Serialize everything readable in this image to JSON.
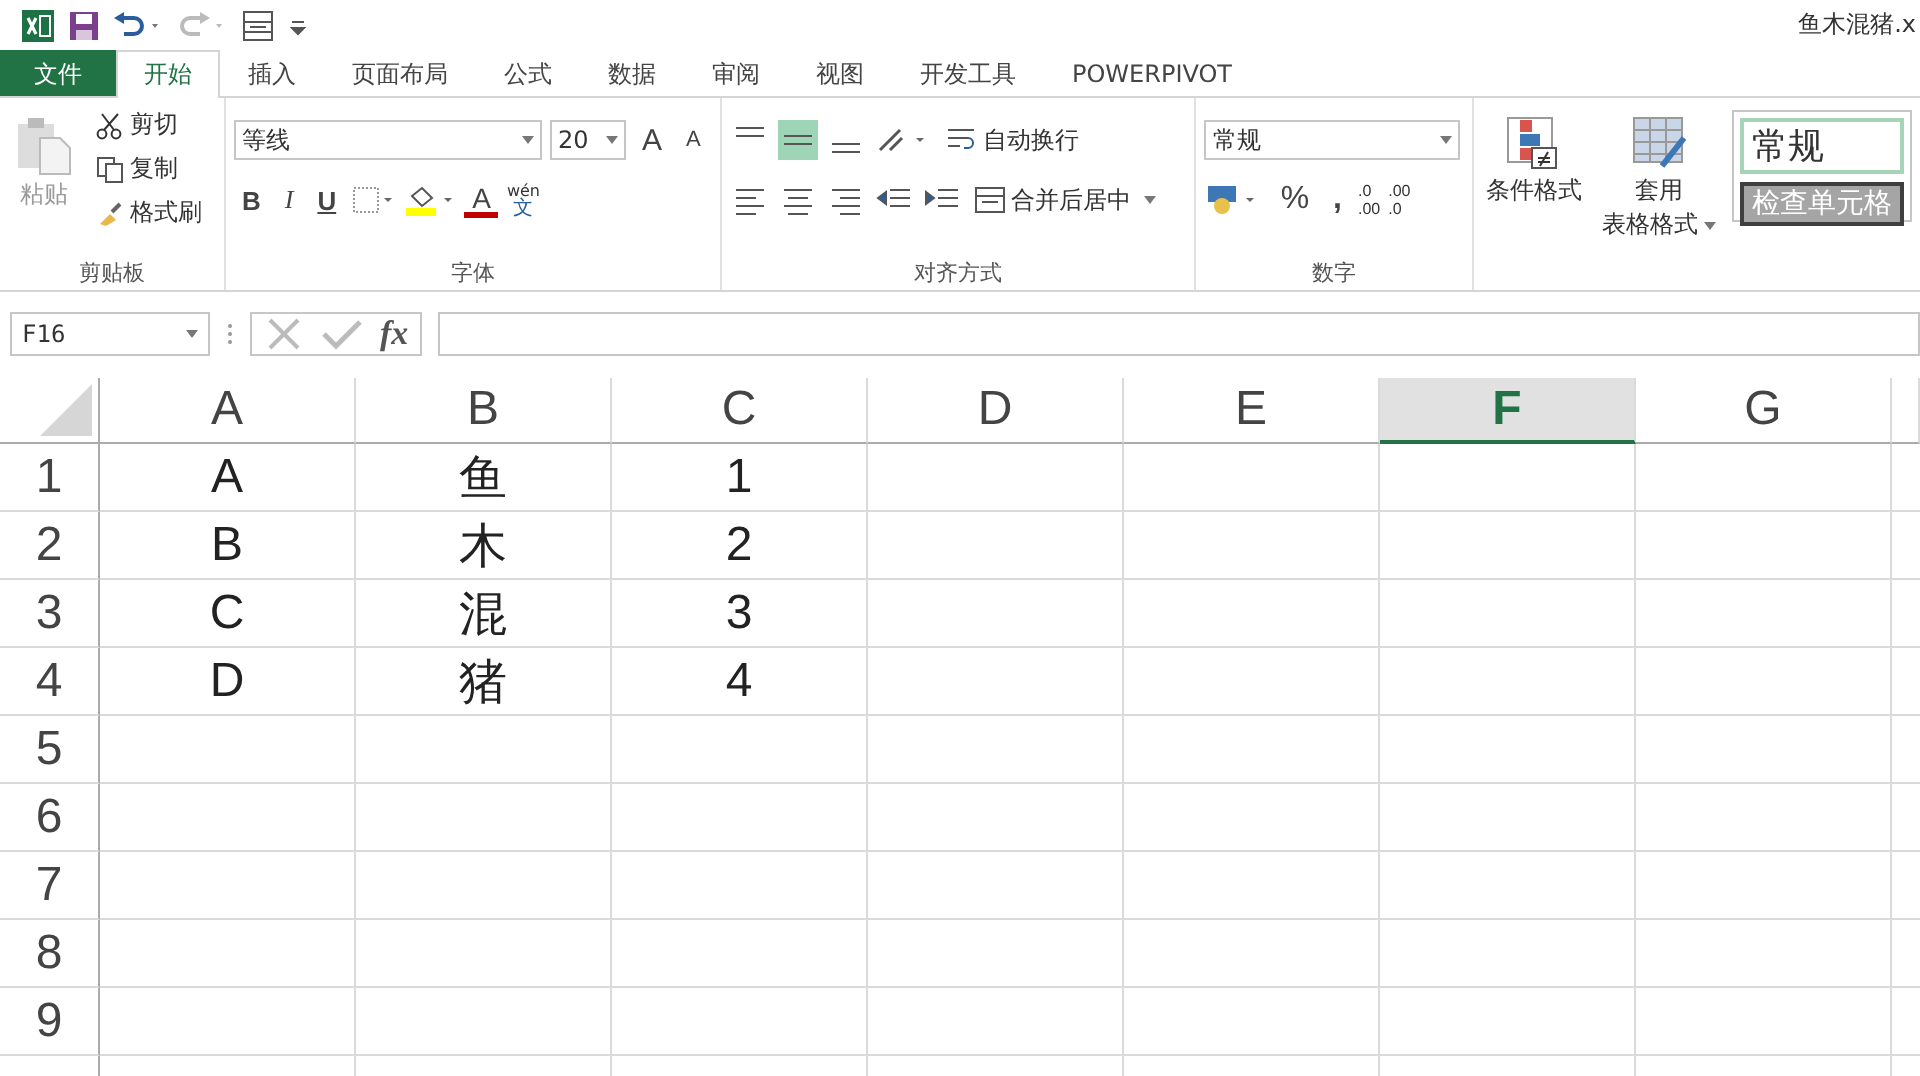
{
  "window": {
    "title": "鱼木混猪.x"
  },
  "tabs": [
    {
      "label": "文件",
      "kind": "file",
      "selected": false
    },
    {
      "label": "开始",
      "kind": "tab",
      "selected": true
    },
    {
      "label": "插入",
      "kind": "tab",
      "selected": false
    },
    {
      "label": "页面布局",
      "kind": "tab",
      "selected": false
    },
    {
      "label": "公式",
      "kind": "tab",
      "selected": false
    },
    {
      "label": "数据",
      "kind": "tab",
      "selected": false
    },
    {
      "label": "审阅",
      "kind": "tab",
      "selected": false
    },
    {
      "label": "视图",
      "kind": "tab",
      "selected": false
    },
    {
      "label": "开发工具",
      "kind": "tab",
      "selected": false
    },
    {
      "label": "POWERPIVOT",
      "kind": "tab",
      "selected": false
    }
  ],
  "ribbon": {
    "clipboard": {
      "label": "剪贴板",
      "paste": "粘贴",
      "cut": "剪切",
      "copy": "复制",
      "format_painter": "格式刷"
    },
    "font": {
      "label": "字体",
      "font_name": "等线",
      "font_size": "20",
      "grow": "A",
      "shrink": "A",
      "bold": "B",
      "italic": "I",
      "underline": "U",
      "font_color": "A",
      "phonetic_top": "wén",
      "phonetic_bottom": "文"
    },
    "alignment": {
      "label": "对齐方式",
      "middle_align_selected": true,
      "wrap_text": "自动换行",
      "merge_center": "合并后居中"
    },
    "number": {
      "label": "数字",
      "format": "常规",
      "percent": "%",
      "comma": ",",
      "increase_decimal": {
        "top": ".0",
        "bottom": ".00"
      },
      "decrease_decimal": {
        "top": ".00",
        "bottom": ".0"
      }
    },
    "styles": {
      "conditional_format": "条件格式",
      "table_format_top": "套用",
      "table_format_bottom": "表格格式",
      "cell_styles": [
        {
          "label": "常规",
          "kind": "normal"
        },
        {
          "label": "检查单元格",
          "kind": "check"
        }
      ]
    }
  },
  "formula_bar": {
    "name_box": "F16",
    "fx": "fx"
  },
  "sheet": {
    "columns": [
      {
        "label": "A",
        "selected": false
      },
      {
        "label": "B",
        "selected": false
      },
      {
        "label": "C",
        "selected": false
      },
      {
        "label": "D",
        "selected": false
      },
      {
        "label": "E",
        "selected": false
      },
      {
        "label": "F",
        "selected": true
      },
      {
        "label": "G",
        "selected": false
      }
    ],
    "rows": [
      {
        "header": "1",
        "cells": [
          "A",
          "鱼",
          "1"
        ]
      },
      {
        "header": "2",
        "cells": [
          "B",
          "木",
          "2"
        ]
      },
      {
        "header": "3",
        "cells": [
          "C",
          "混",
          "3"
        ]
      },
      {
        "header": "4",
        "cells": [
          "D",
          "猪",
          "4"
        ]
      },
      {
        "header": "5",
        "cells": []
      },
      {
        "header": "6",
        "cells": []
      },
      {
        "header": "7",
        "cells": []
      },
      {
        "header": "8",
        "cells": []
      },
      {
        "header": "9",
        "cells": []
      }
    ]
  }
}
